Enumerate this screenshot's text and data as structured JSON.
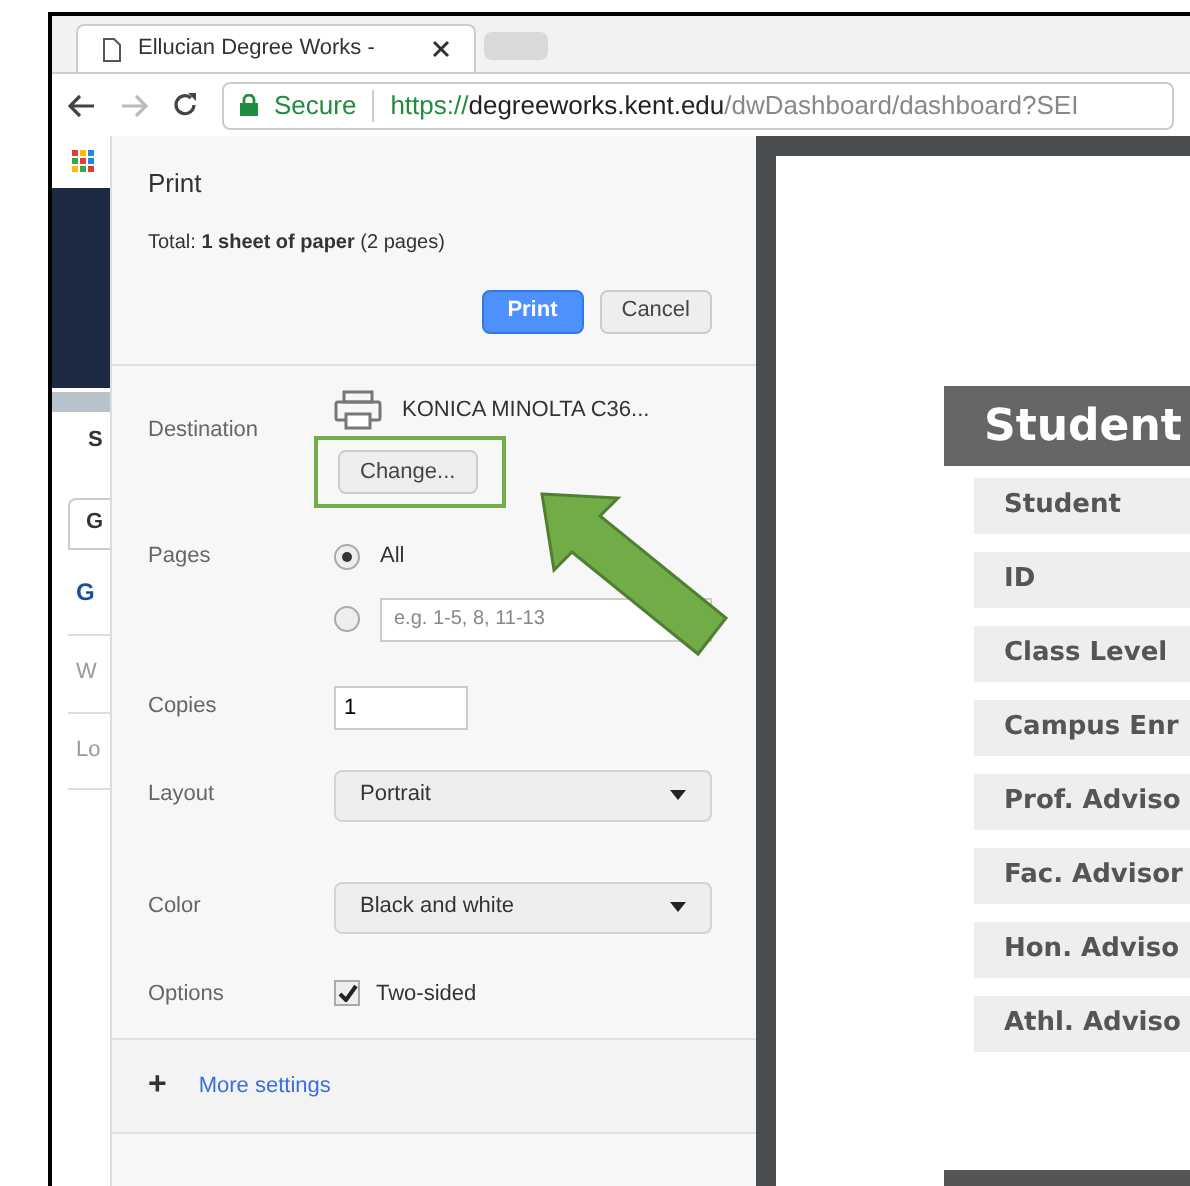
{
  "browser": {
    "tab": {
      "title": "Ellucian Degree Works - "
    },
    "address": {
      "secure_label": "Secure",
      "url_scheme": "https://",
      "url_host": "degreeworks.kent.edu",
      "url_path": "/dwDashboard/dashboard?SEI"
    }
  },
  "background_page": {
    "fragments": [
      {
        "text": "S",
        "kind": "plain"
      },
      {
        "text": "G",
        "kind": "tab"
      },
      {
        "text": "G",
        "kind": "link"
      },
      {
        "text": "W",
        "kind": "muted"
      },
      {
        "text": "Lo",
        "kind": "muted"
      }
    ]
  },
  "print_dialog": {
    "title": "Print",
    "total_label": "Total:",
    "total_bold": "1 sheet of paper",
    "total_rest": "(2 pages)",
    "buttons": [
      {
        "label": "Print",
        "kind": "primary"
      },
      {
        "label": "Cancel",
        "kind": "secondary"
      }
    ],
    "destination": {
      "label": "Destination",
      "printer": "KONICA MINOLTA C36...",
      "change_button": "Change...",
      "highlighted": true
    },
    "pages": {
      "label": "Pages",
      "options": [
        {
          "kind": "all",
          "label": "All",
          "selected": true
        },
        {
          "kind": "custom",
          "placeholder": "e.g. 1-5, 8, 11-13",
          "selected": false
        }
      ]
    },
    "copies": {
      "label": "Copies",
      "value": "1"
    },
    "layout": {
      "label": "Layout",
      "value": "Portrait"
    },
    "color": {
      "label": "Color",
      "value": "Black and white"
    },
    "options": {
      "label": "Options",
      "two_sided": {
        "label": "Two-sided",
        "checked": true
      }
    },
    "more_settings": {
      "icon": "+",
      "label": "More settings"
    }
  },
  "preview": {
    "table_title": "Student",
    "rows": [
      "Student",
      "ID",
      "Class Level",
      "Campus Enr",
      "Prof. Adviso",
      "Fac. Advisor",
      "Hon. Adviso",
      "Athl. Adviso"
    ]
  }
}
